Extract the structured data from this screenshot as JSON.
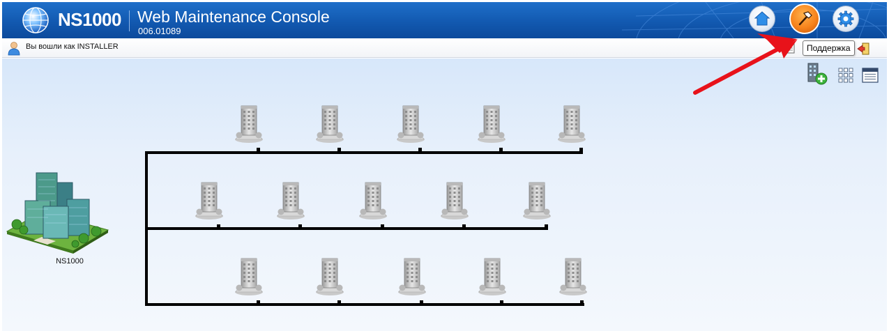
{
  "header": {
    "product_name": "NS1000",
    "console_title": "Web Maintenance Console",
    "version": "006.01089",
    "buttons": [
      {
        "icon": "home-icon"
      },
      {
        "icon": "hammer-icon"
      },
      {
        "icon": "gear-icon"
      }
    ]
  },
  "login_bar": {
    "text": "Вы вошли как INSTALLER",
    "tooltip": "Поддержка"
  },
  "toolbar": {
    "add_site_icon": "add-building-icon",
    "grid_view_icon": "grid-icon",
    "list_view_icon": "list-icon"
  },
  "topology": {
    "main_site_label": "NS1000",
    "rows": [
      {
        "nodes": 5
      },
      {
        "nodes": 5
      },
      {
        "nodes": 5
      }
    ]
  },
  "colors": {
    "header_blue": "#1259b0",
    "accent_orange": "#f7831c",
    "arrow_red": "#e8121a"
  }
}
